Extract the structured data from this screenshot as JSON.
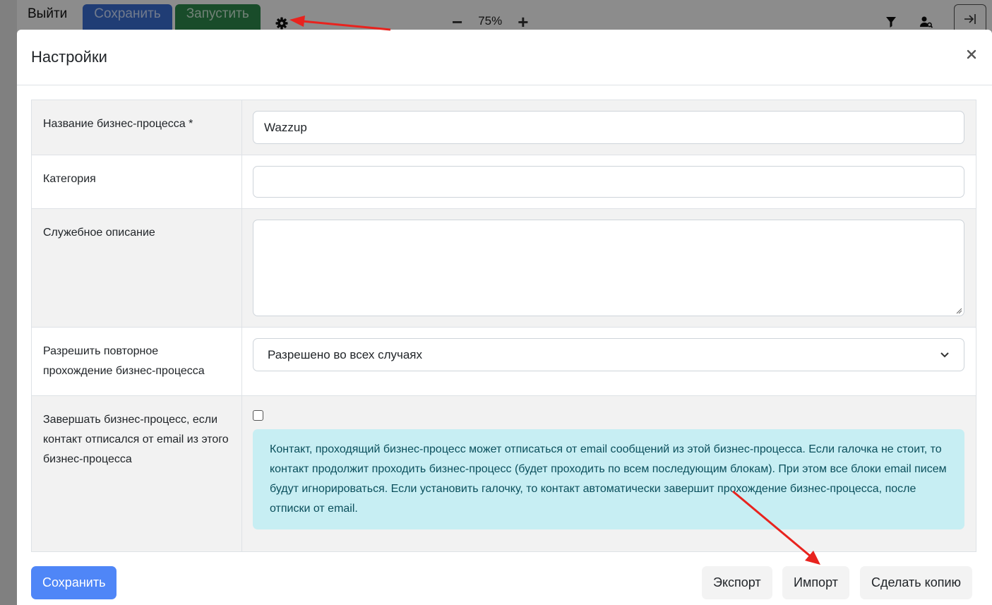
{
  "toolbar": {
    "exit_label": "Выйти",
    "save_label": "Сохранить",
    "run_label": "Запустить",
    "zoom_value": "75%",
    "zoom_minus": "−",
    "zoom_plus": "+",
    "icons": [
      "gear-icon",
      "filter-icon",
      "user-search-icon",
      "collapse-panel-icon"
    ]
  },
  "modal": {
    "title": "Настройки",
    "close_icon": "close-icon",
    "fields": {
      "name_label": "Название бизнес-процесса *",
      "name_value": "Wazzup",
      "category_label": "Категория",
      "category_value": "",
      "description_label": "Служебное описание",
      "description_value": "",
      "repeat_label": "Разрешить повторное прохождение бизнес-процесса",
      "repeat_value": "Разрешено во всех случаях",
      "unsubscribe_label": "Завершать бизнес-процесс, если контакт отписался от email из этого бизнес-процесса",
      "unsubscribe_checked": false,
      "unsubscribe_info": "Контакт, проходящий бизнес-процесс может отписаться от email сообщений из этой бизнес-процесса. Если галочка не стоит, то контакт продолжит проходить бизнес-процесс (будет проходить по всем последующим блокам). При этом все блоки email писем будут игнорироваться. Если установить галочку, то контакт автоматически завершит прохождение бизнес-процесса, после отписки от email."
    },
    "footer": {
      "save_label": "Сохранить",
      "export_label": "Экспорт",
      "import_label": "Импорт",
      "copy_label": "Сделать копию"
    }
  },
  "colors": {
    "primary": "#4f86f7",
    "info_bg": "#c7eef3",
    "info_text": "#0b4f5c",
    "annotation_arrow": "#e8231e"
  }
}
